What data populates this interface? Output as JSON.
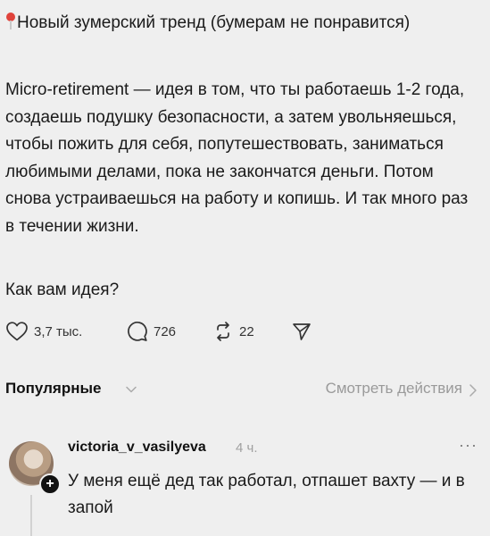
{
  "post": {
    "title": "Новый зумерский тренд (бумерам не понравится)",
    "body": "Micro-retirement — идея в том, что ты работаешь 1-2 года, создаешь подушку безопасности, а затем увольняешься, чтобы пожить для себя, попутешествовать, заниматься любимыми делами, пока не закончатся деньги. Потом снова устраиваешься на работу и копишь. И так много раз в течении жизни.",
    "question": "Как вам идея?",
    "pin_icon": "round-pushpin-icon"
  },
  "actions": {
    "likes": "3,7 тыс.",
    "comments": "726",
    "reposts": "22"
  },
  "sort": {
    "label": "Популярные",
    "view_activity": "Смотреть действия"
  },
  "comment": {
    "username": "victoria_v_vasilyeva",
    "time": "4 ч.",
    "more": "···",
    "text": "У меня ещё дед так работал, отпашет вахту — и в запой"
  },
  "colors": {
    "background": "#efefef",
    "pin": "#e0433b",
    "muted": "#9a9a9a"
  }
}
